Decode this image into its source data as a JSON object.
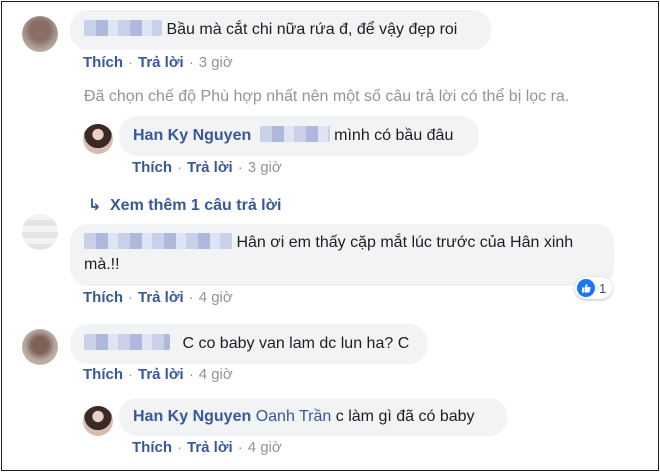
{
  "comments": [
    {
      "text": "Bầu mà cắt chi nữa rứa đ, để vậy đẹp roi",
      "actions": {
        "like": "Thích",
        "reply": "Trả lời",
        "time": "3 giờ"
      }
    },
    {
      "author": "Han Ky Nguyen",
      "text": "mình có bầu đâu",
      "actions": {
        "like": "Thích",
        "reply": "Trả lời",
        "time": "3 giờ"
      }
    },
    {
      "text": "Hân ơi em thấy cặp mắt lúc trước của Hân xinh mà.!!",
      "actions": {
        "like": "Thích",
        "reply": "Trả lời",
        "time": "4 giờ"
      },
      "reaction_count": "1"
    },
    {
      "text": "C co baby van lam dc lun ha? C",
      "actions": {
        "like": "Thích",
        "reply": "Trả lời",
        "time": "4 giờ"
      }
    },
    {
      "author": "Han Ky Nguyen",
      "mention": "Oanh Trần",
      "text": "c làm gì đã có baby",
      "actions": {
        "like": "Thích",
        "reply": "Trả lời",
        "time": "4 giờ"
      }
    }
  ],
  "filter_notice": "Đã chọn chế độ Phù hợp nhất nên một số câu trả lời có thể bị lọc ra.",
  "view_more": "Xem thêm 1 câu trả lời",
  "colors": {
    "link": "#385898",
    "bubble": "#f2f3f5",
    "meta": "#90949c",
    "like_blue": "#1877f2"
  },
  "icons": {
    "reply_arrow": "reply-arrow-icon",
    "like_badge": "thumbs-up-icon"
  }
}
